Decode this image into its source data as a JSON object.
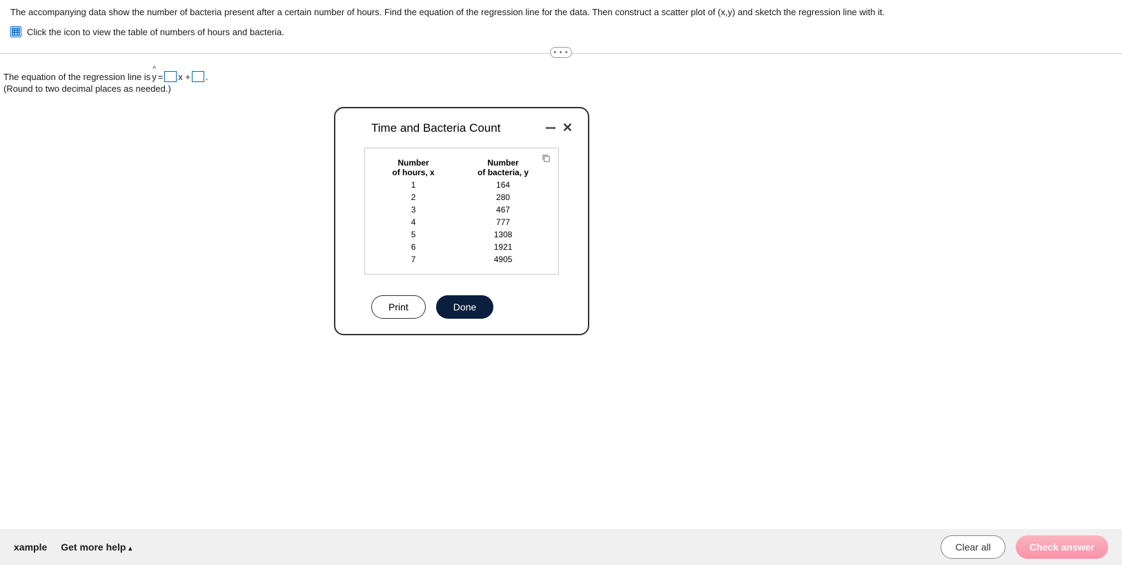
{
  "question": "The accompanying data show the number of bacteria present after a certain number of hours. Find the equation of the regression line for the data. Then construct a scatter plot of (x,y) and sketch the regression line with it.",
  "table_link": "Click the icon to view the table of numbers of hours and bacteria.",
  "equation": {
    "prefix": "The equation of the regression line is ",
    "y_label": "y",
    "equals": " = ",
    "x_label": "x + ",
    "period": "."
  },
  "hint": "(Round to two decimal places as needed.)",
  "modal": {
    "title": "Time and Bacteria Count",
    "col1_line1": "Number",
    "col1_line2": "of hours, x",
    "col2_line1": "Number",
    "col2_line2": "of bacteria, y",
    "rows": [
      {
        "x": "1",
        "y": "164"
      },
      {
        "x": "2",
        "y": "280"
      },
      {
        "x": "3",
        "y": "467"
      },
      {
        "x": "4",
        "y": "777"
      },
      {
        "x": "5",
        "y": "1308"
      },
      {
        "x": "6",
        "y": "1921"
      },
      {
        "x": "7",
        "y": "4905"
      }
    ],
    "print": "Print",
    "done": "Done"
  },
  "footer": {
    "example": "xample",
    "more_help": "Get more help",
    "clear": "Clear all",
    "check": "Check answer"
  },
  "ellipsis": "• • •"
}
